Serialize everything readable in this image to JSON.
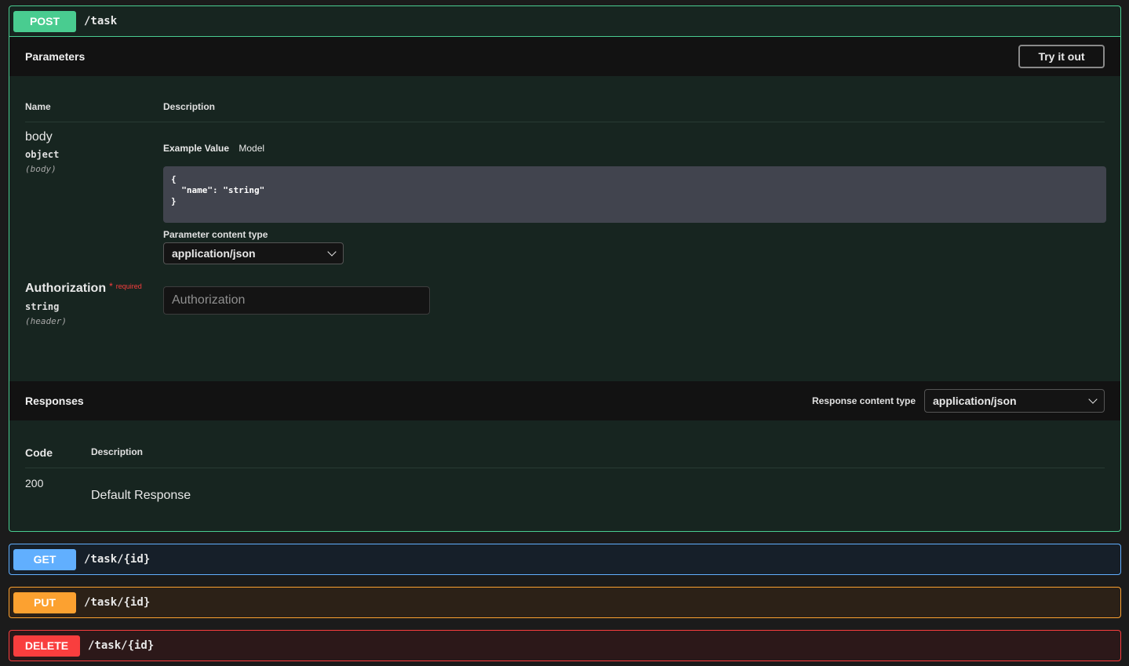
{
  "post": {
    "method": "POST",
    "path": "/task",
    "parameters_title": "Parameters",
    "try_it_out": "Try it out",
    "columns": {
      "name": "Name",
      "description": "Description"
    },
    "body_param": {
      "name": "body",
      "type": "object",
      "in": "(body)",
      "tab_example": "Example Value",
      "tab_model": "Model",
      "example": "{\n  \"name\": \"string\"\n}",
      "content_type_label": "Parameter content type",
      "content_type_value": "application/json"
    },
    "auth_param": {
      "name": "Authorization",
      "required_star": "*",
      "required_label": "required",
      "type": "string",
      "in": "(header)",
      "placeholder": "Authorization"
    },
    "responses": {
      "title": "Responses",
      "content_type_label": "Response content type",
      "content_type_value": "application/json",
      "col_code": "Code",
      "col_description": "Description",
      "rows": [
        {
          "code": "200",
          "description": "Default Response"
        }
      ]
    }
  },
  "get": {
    "method": "GET",
    "path": "/task/{id}"
  },
  "put": {
    "method": "PUT",
    "path": "/task/{id}"
  },
  "delete": {
    "method": "DELETE",
    "path": "/task/{id}"
  },
  "colors": {
    "post": "#49cc90",
    "get": "#61affe",
    "put": "#fca130",
    "delete": "#f93e3e"
  }
}
